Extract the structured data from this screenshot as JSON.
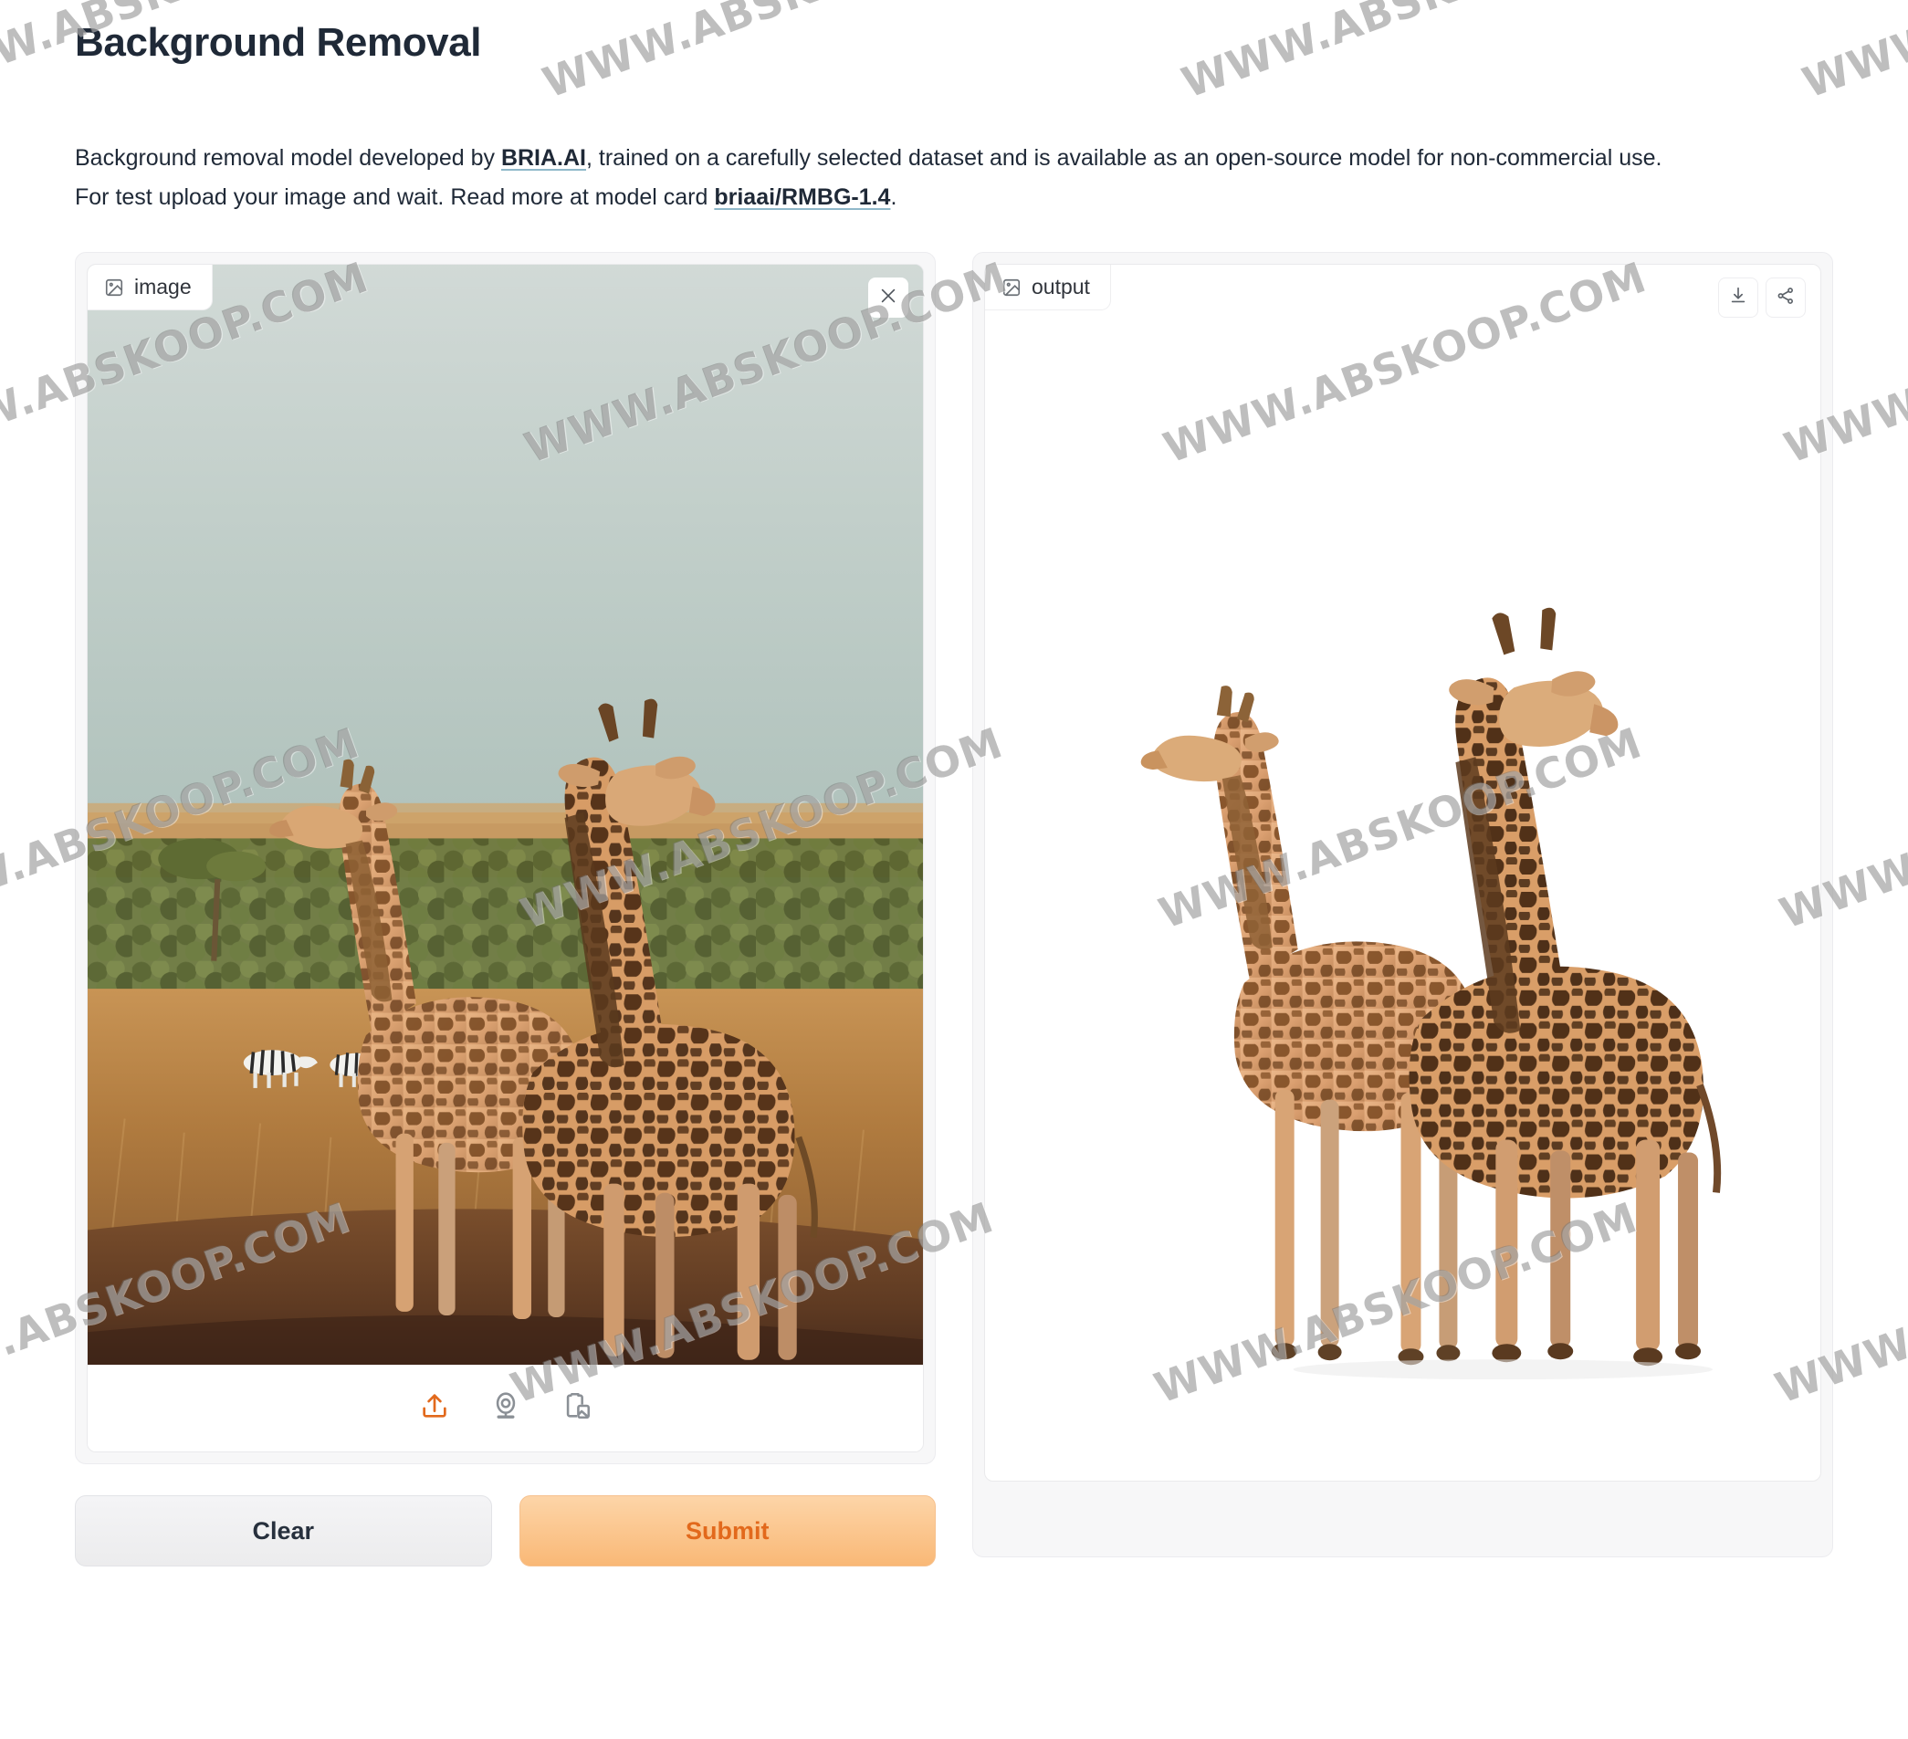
{
  "page": {
    "title": "Background Removal",
    "description_line1_pre": "Background removal model developed by ",
    "description_link1": "BRIA.AI",
    "description_line1_post": ", trained on a carefully selected dataset and is available as an open-source model for non-commercial use.",
    "description_line2_pre": "For test upload your image and wait. Read more at model card ",
    "description_link2": "briaai/RMBG-1.4",
    "description_line2_post": "."
  },
  "watermark": {
    "text": "WWW.ABSKOOP.COM",
    "color": "#787878"
  },
  "input_panel": {
    "tag_label": "image",
    "tag_icon": "image-icon",
    "close_icon": "close-icon",
    "sources": [
      {
        "name": "upload-button",
        "icon": "upload-icon",
        "color": "#e2691c"
      },
      {
        "name": "webcam-button",
        "icon": "webcam-icon",
        "color": "#8b9096"
      },
      {
        "name": "paste-clipboard-button",
        "icon": "clipboard-image-icon",
        "color": "#8b9096"
      }
    ],
    "photo_alt": "Two giraffes standing on a savanna with zebras and bushes in the background"
  },
  "output_panel": {
    "tag_label": "output",
    "tag_icon": "image-icon",
    "actions": [
      {
        "name": "download-button",
        "icon": "download-icon"
      },
      {
        "name": "share-button",
        "icon": "share-icon"
      }
    ],
    "result_alt": "Two giraffes with the background removed on a white backdrop"
  },
  "actions": {
    "clear_label": "Clear",
    "submit_label": "Submit",
    "submit_color": "#e2691c"
  }
}
